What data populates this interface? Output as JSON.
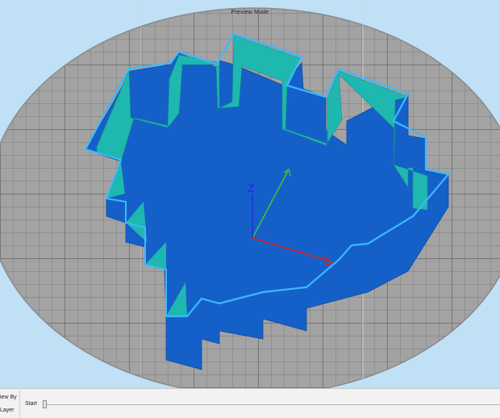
{
  "viewport": {
    "mode_label": "Preview Mode"
  },
  "axes": {
    "z_label": "Z",
    "x_color": "#e02020",
    "y_color": "#3cc03c",
    "z_color": "#2030e0"
  },
  "model": {
    "outer_wall_color": "#1560c8",
    "inner_wall_color": "#1fb8b0",
    "rim_color": "#3db8ff"
  },
  "bottom_bar": {
    "view_by_label": "iew By",
    "layer_label": "Layer",
    "start_label": "Start"
  }
}
